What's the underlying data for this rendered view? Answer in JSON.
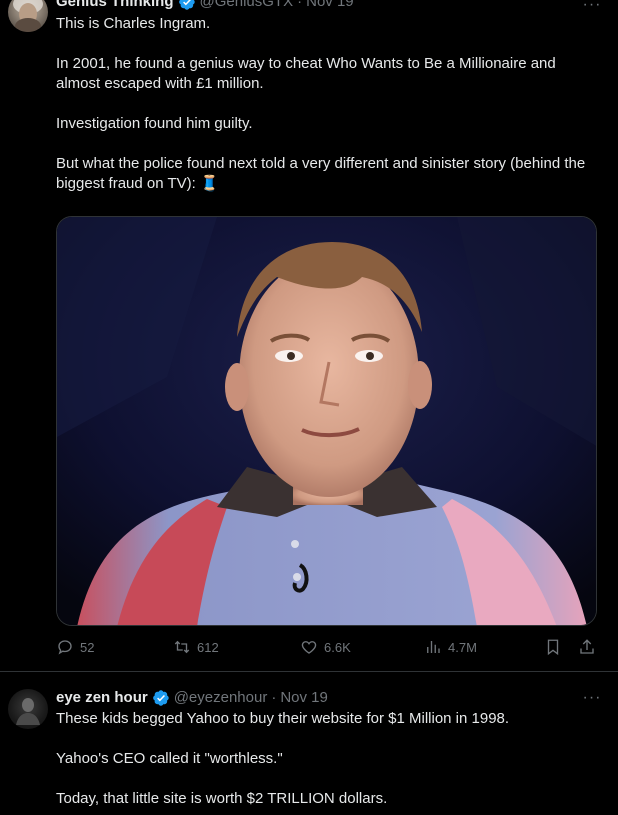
{
  "tweets": [
    {
      "author": {
        "name": "Genius Thinking",
        "handle": "@GeniusGTX",
        "date": "Nov 19"
      },
      "paragraphs": [
        "This is Charles Ingram.",
        "In 2001, he found a genius way to cheat Who Wants to Be a Millionaire and almost escaped with £1 million.",
        "Investigation found him guilty.",
        "But what the police found next told a very different and sinister story (behind the biggest fraud on TV): 🧵"
      ],
      "stats": {
        "replies": "52",
        "retweets": "612",
        "likes": "6.6K",
        "views": "4.7M"
      }
    },
    {
      "author": {
        "name": "eye zen hour",
        "handle": "@eyezenhour",
        "date": "Nov 19"
      },
      "paragraphs": [
        "These kids begged Yahoo to buy their website for $1 Million in 1998.",
        "Yahoo's CEO called it \"worthless.\"",
        "Today, that little site is worth $2 TRILLION dollars."
      ]
    }
  ],
  "ui": {
    "more_glyph": "···",
    "dot": "·"
  },
  "colors": {
    "background": "#000000",
    "text": "#e7e9ea",
    "muted": "#71767b",
    "verified": "#1d9bf0",
    "divider": "#2f3336"
  }
}
